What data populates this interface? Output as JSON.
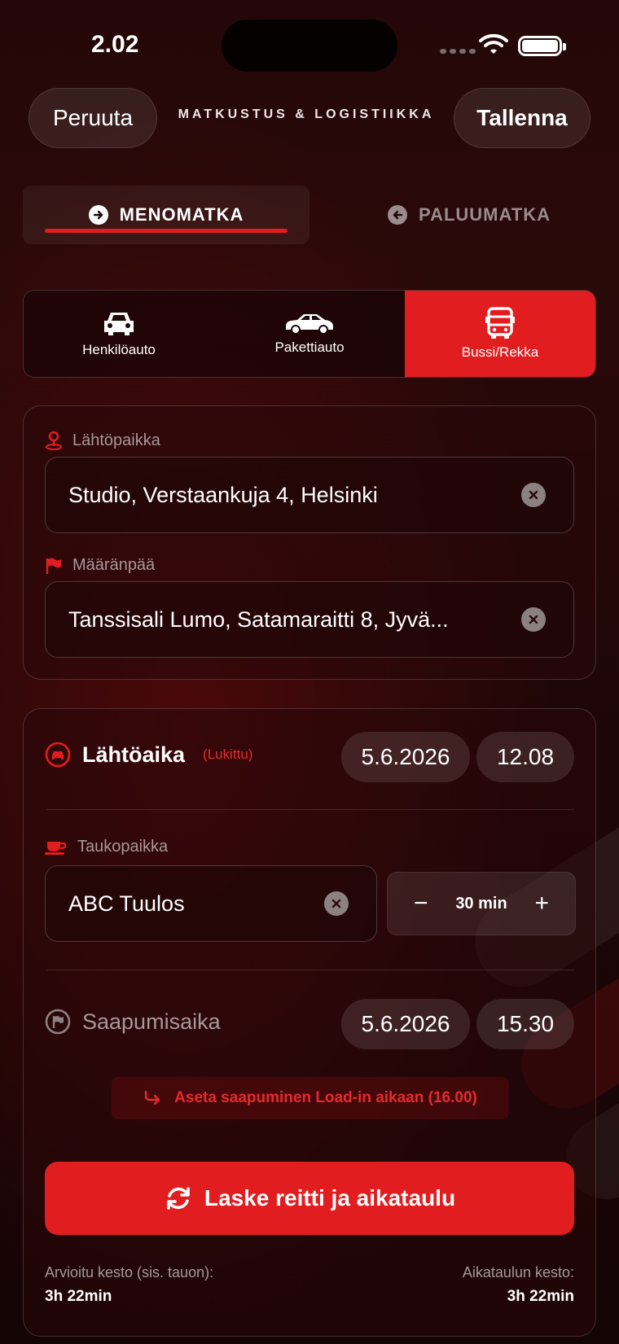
{
  "status": {
    "time": "2.02"
  },
  "header": {
    "cancel_label": "Peruuta",
    "title": "MATKUSTUS & LOGISTIIKKA",
    "save_label": "Tallenna"
  },
  "trip_tabs": [
    {
      "label": "MENOMATKA",
      "icon": "arrow-right-circle-icon",
      "active": true
    },
    {
      "label": "PALUUMATKA",
      "icon": "arrow-left-circle-icon",
      "active": false
    }
  ],
  "vehicles": [
    {
      "label": "Henkilöauto",
      "icon": "car-front-icon",
      "active": false
    },
    {
      "label": "Pakettiauto",
      "icon": "car-side-icon",
      "active": false
    },
    {
      "label": "Bussi/Rekka",
      "icon": "bus-icon",
      "active": true
    }
  ],
  "route": {
    "origin_label": "Lähtöpaikka",
    "origin_value": "Studio, Verstaankuja 4, Helsinki",
    "destination_label": "Määränpää",
    "destination_value": "Tanssisali Lumo, Satamaraitti 8, Jyvä..."
  },
  "schedule": {
    "departure_label": "Lähtöaika",
    "departure_locked": "(Lukittu)",
    "departure_date": "5.6.2026",
    "departure_time": "12.08",
    "break_label": "Taukopaikka",
    "break_value": "ABC Tuulos",
    "break_minus": "−",
    "break_duration": "30 min",
    "break_plus": "+",
    "arrival_label": "Saapumisaika",
    "arrival_date": "5.6.2026",
    "arrival_time": "15.30",
    "hint": "Aseta saapuminen Load-in aikaan (16.00)",
    "calc_label": "Laske reitti ja aikataulu",
    "estimated_label": "Arvioitu kesto (sis. tauon):",
    "estimated_value": "3h 22min",
    "schedule_label": "Aikataulun kesto:",
    "schedule_value": "3h 22min"
  },
  "colors": {
    "accent": "#e21d1f",
    "background": "#1d0606"
  }
}
